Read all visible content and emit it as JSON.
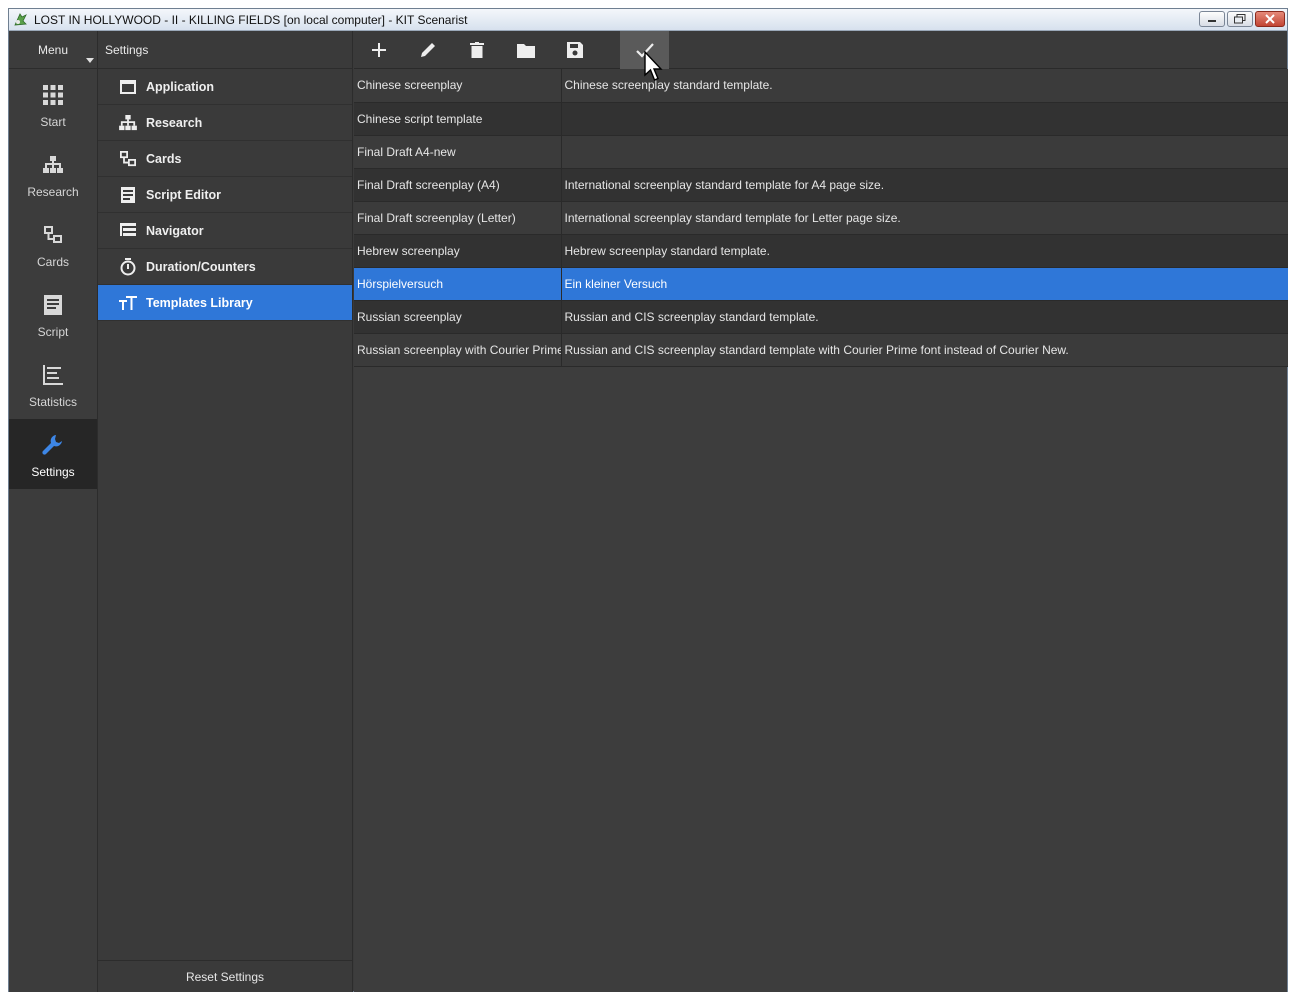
{
  "window": {
    "title": "LOST IN HOLLYWOOD - II - KILLING FIELDS [on local computer] - KIT Scenarist"
  },
  "nav": {
    "menu_label": "Menu",
    "items": [
      {
        "label": "Start",
        "icon": "grid-icon"
      },
      {
        "label": "Research",
        "icon": "hierarchy-icon"
      },
      {
        "label": "Cards",
        "icon": "cards-icon"
      },
      {
        "label": "Script",
        "icon": "script-icon"
      },
      {
        "label": "Statistics",
        "icon": "statistics-icon"
      },
      {
        "label": "Settings",
        "icon": "wrench-icon"
      }
    ],
    "active": "Settings"
  },
  "settings": {
    "header": "Settings",
    "items": [
      {
        "label": "Application",
        "icon": "window-icon"
      },
      {
        "label": "Research",
        "icon": "hierarchy-icon"
      },
      {
        "label": "Cards",
        "icon": "cards-icon"
      },
      {
        "label": "Script Editor",
        "icon": "document-icon"
      },
      {
        "label": "Navigator",
        "icon": "navigator-icon"
      },
      {
        "label": "Duration/Counters",
        "icon": "stopwatch-icon"
      },
      {
        "label": "Templates Library",
        "icon": "text-size-icon"
      }
    ],
    "active": "Templates Library",
    "reset_label": "Reset Settings"
  },
  "toolbar": {
    "buttons": [
      "add-icon",
      "edit-icon",
      "delete-icon",
      "folder-icon",
      "save-icon",
      "check-icon"
    ]
  },
  "templates": {
    "rows": [
      {
        "name": "Chinese screenplay",
        "description": "Chinese screenplay standard template."
      },
      {
        "name": "Chinese script template",
        "description": ""
      },
      {
        "name": "Final Draft A4-new",
        "description": ""
      },
      {
        "name": "Final Draft screenplay (A4)",
        "description": "International screenplay standard template for A4 page size."
      },
      {
        "name": "Final Draft screenplay (Letter)",
        "description": "International screenplay standard template for Letter page size."
      },
      {
        "name": "Hebrew screenplay",
        "description": "Hebrew screenplay standard template."
      },
      {
        "name": "Hörspielversuch",
        "description": "Ein kleiner Versuch"
      },
      {
        "name": "Russian screenplay",
        "description": "Russian and CIS screenplay standard template."
      },
      {
        "name": "Russian screenplay with Courier Prime",
        "description": "Russian and CIS screenplay standard template with Courier Prime font instead of Courier New."
      }
    ],
    "selected": "Hörspielversuch"
  },
  "colors": {
    "accent": "#2f77d8",
    "panel": "#3a3a3a",
    "dark_row": "#323232"
  }
}
